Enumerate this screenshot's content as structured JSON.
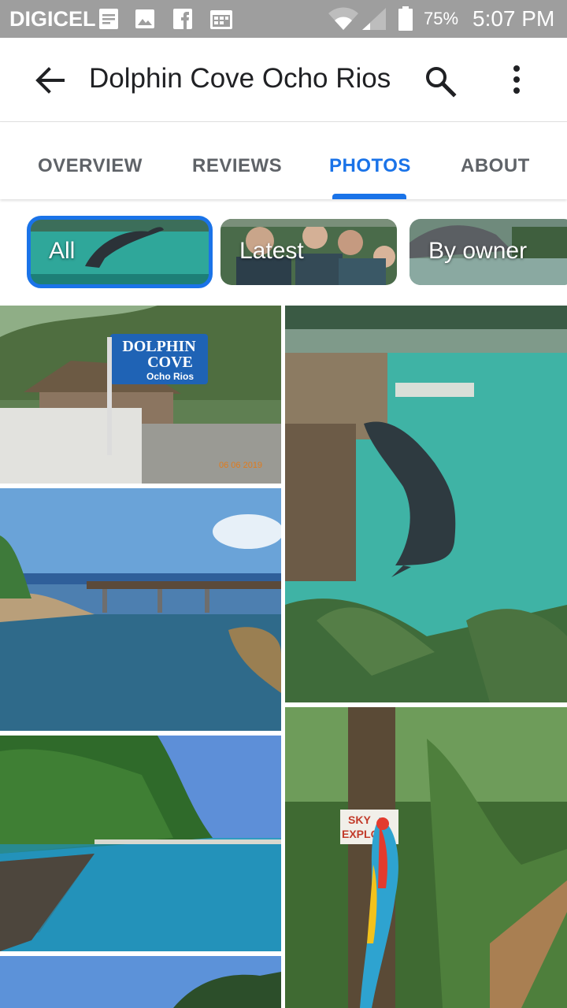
{
  "status_bar": {
    "carrier": "DIGICEL",
    "battery": "75%",
    "time": "5:07 PM",
    "icons": [
      "doc-notification-icon",
      "image-notification-icon",
      "facebook-icon",
      "calendar-notification-icon",
      "wifi-icon",
      "signal-icon",
      "battery-icon"
    ]
  },
  "toolbar": {
    "title": "Dolphin Cove Ocho Rios",
    "icons": [
      "back-arrow-icon",
      "search-icon",
      "more-vert-icon"
    ]
  },
  "tabs": [
    {
      "label": "OVERVIEW",
      "active": false
    },
    {
      "label": "REVIEWS",
      "active": false
    },
    {
      "label": "PHOTOS",
      "active": true
    },
    {
      "label": "ABOUT",
      "active": false
    }
  ],
  "chips": [
    {
      "label": "All",
      "selected": true
    },
    {
      "label": "Latest",
      "selected": false
    },
    {
      "label": "By owner",
      "selected": false
    }
  ],
  "photos": {
    "sign_text": [
      "DOLPHIN",
      "COVE",
      "Ocho Rios"
    ],
    "photo_date": "06 06 2019",
    "tree_sign": [
      "SKY",
      "EXPLOR"
    ]
  },
  "colors": {
    "accent": "#1a73e8",
    "status_bar": "#9e9e9e",
    "tab_inactive": "#5f6368"
  }
}
